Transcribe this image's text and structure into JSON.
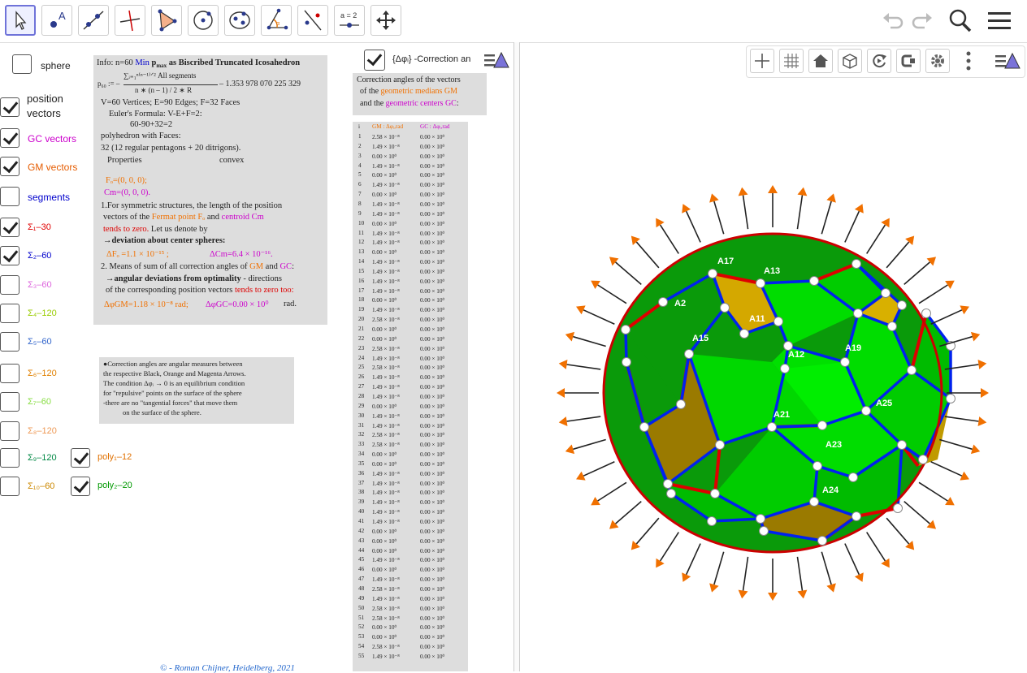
{
  "toolbar": {
    "tools": [
      {
        "name": "move-tool-icon"
      },
      {
        "name": "point-tool-icon",
        "glyph": "A"
      },
      {
        "name": "line-tool-icon"
      },
      {
        "name": "perpendicular-tool-icon"
      },
      {
        "name": "polygon-tool-icon"
      },
      {
        "name": "circle-tool-icon"
      },
      {
        "name": "conic-tool-icon"
      },
      {
        "name": "angle-tool-icon"
      },
      {
        "name": "reflect-tool-icon"
      },
      {
        "name": "slider-tool-icon",
        "glyph": "a = 2"
      },
      {
        "name": "move-graphics-tool-icon"
      }
    ]
  },
  "sidebar": {
    "sphere": {
      "label": "sphere",
      "checked": false
    },
    "position_vectors": {
      "label_line1": "position",
      "label_line2": "vectors",
      "checked": true
    },
    "gc_vectors": {
      "label": "GC vectors",
      "checked": true,
      "color": "#cc00cc"
    },
    "gm_vectors": {
      "label": "GM vectors",
      "checked": true,
      "color": "#e65c00"
    },
    "segments": {
      "label": "segments",
      "checked": false,
      "color": "#0000cc"
    },
    "sigma": [
      {
        "label": "Σ₁–30",
        "checked": true,
        "color": "#e00000"
      },
      {
        "label": "Σ₂–60",
        "checked": true,
        "color": "#0000cc"
      },
      {
        "label": "Σ₃–60",
        "checked": false,
        "color": "#dd66dd"
      },
      {
        "label": "Σ₄–120",
        "checked": false,
        "color": "#99cc00"
      },
      {
        "label": "Σ₅–60",
        "checked": false,
        "color": "#3366cc"
      },
      {
        "label": "Σ₆–120",
        "checked": false,
        "color": "#e08000"
      },
      {
        "label": "Σ₇–60",
        "checked": false,
        "color": "#88dd44"
      },
      {
        "label": "Σ₈–120",
        "checked": false,
        "color": "#ee9955"
      },
      {
        "label": "Σ₉–120",
        "checked": false,
        "color": "#008844"
      },
      {
        "label": "Σ₁₀–60",
        "checked": false,
        "color": "#cc8800"
      }
    ],
    "poly1": {
      "label": "poly₁–12",
      "checked": true,
      "color": "#e07000"
    },
    "poly2": {
      "label": "poly₂–20",
      "checked": true,
      "color": "#009900"
    }
  },
  "info": {
    "line1_a": "Info: n=60 ",
    "line1_min": "Min",
    "line1_b": " p",
    "line1_sub": "max",
    "line1_c": " as Biscribed Truncated Icosahedron",
    "formula_lhs": "p₆₀ := –",
    "formula_sum": "∑ᵢ₌₁ⁿ⁽ⁿ⁻¹⁾ᐟ² All segments",
    "formula_den": "n ∗ (n – 1) / 2 ∗ R",
    "formula_val": "– 1.353 978 070 225 329",
    "vef": "V=60 Vertices; E=90 Edges; F=32 Faces",
    "euler": "Euler's Formula: V-E+F=2:",
    "euler_val": "60-90+32=2",
    "faces1": "polyhedron with Faces:",
    "faces2": "32  (12 regular pentagons + 20 ditrigons).",
    "props": "Properties",
    "convex": "convex",
    "fo": "Fₒ=(0, 0, 0);",
    "cm": "Cm=(0, 0, 0).",
    "p1_a": "1.For symmetric structures, the length of the position",
    "p1_b1": "vectors of the ",
    "p1_b2": "Fermat point  Fₒ",
    "p1_b3": " and ",
    "p1_b4": "centroid Cm",
    "p1_c": "tends to zero.",
    "p1_c2": " Let us denote by",
    "p1_d": "→deviation about center spheres:",
    "dfo": "ΔFₒ =1.1 × 10⁻¹⁵ ;",
    "dcm": "ΔCm=6.4 × 10⁻¹⁶.",
    "p2_a1": "2. Means of sum of all correction angles of ",
    "p2_gm": "GM",
    "p2_and": " and ",
    "p2_gc": "GC",
    "p2_colon": ":",
    "p2_b": "→angular deviations from optimality",
    "p2_b2": " - directions",
    "p2_c1": "of the corresponding position vectors ",
    "p2_c2": "tends to zero too:",
    "dgm": "ΔφGM=1.18 × 10⁻⁸  rad;",
    "dgc": "ΔφGC=0.00 × 10⁰",
    "rad": "rad."
  },
  "note": {
    "l1": "●Correction angles are angular measures between",
    "l2": "the respective Black, Orange and Magenta Arrows.",
    "l3": "The condition Δφᵢ → 0 is an equilibrium condition",
    "l4": "for \"repulsive\" points on the surface of the sphere",
    "l5": "-there are no \"tangential forces\" that move them",
    "l6": "on the surface of the sphere."
  },
  "correction": {
    "checkbox_label": "{Δφᵢ} -Correction an",
    "checked": true,
    "l1": "Correction angles of the vectors",
    "l2a": "of the  ",
    "l2b": "geometric medians GM",
    "l3a": "and the ",
    "l3b": "geometric centers  GC",
    "l3c": ":"
  },
  "table": {
    "h_i": "i",
    "h_gm": "GM : Δφᵢ,rad",
    "h_gc": "GC : Δφᵢ,rad",
    "rows": [
      [
        "1",
        "2.58 × 10⁻⁸",
        "0.00 × 10⁰"
      ],
      [
        "2",
        "1.49 × 10⁻⁸",
        "0.00 × 10⁰"
      ],
      [
        "3",
        "0.00 × 10⁰",
        "0.00 × 10⁰"
      ],
      [
        "4",
        "1.49 × 10⁻⁸",
        "0.00 × 10⁰"
      ],
      [
        "5",
        "0.00 × 10⁰",
        "0.00 × 10⁰"
      ],
      [
        "6",
        "1.49 × 10⁻⁸",
        "0.00 × 10⁰"
      ],
      [
        "7",
        "0.00 × 10⁰",
        "0.00 × 10⁰"
      ],
      [
        "8",
        "1.49 × 10⁻⁸",
        "0.00 × 10⁰"
      ],
      [
        "9",
        "1.49 × 10⁻⁸",
        "0.00 × 10⁰"
      ],
      [
        "10",
        "0.00 × 10⁰",
        "0.00 × 10⁰"
      ],
      [
        "11",
        "1.49 × 10⁻⁸",
        "0.00 × 10⁰"
      ],
      [
        "12",
        "1.49 × 10⁻⁸",
        "0.00 × 10⁰"
      ],
      [
        "13",
        "0.00 × 10⁰",
        "0.00 × 10⁰"
      ],
      [
        "14",
        "1.49 × 10⁻⁸",
        "0.00 × 10⁰"
      ],
      [
        "15",
        "1.49 × 10⁻⁸",
        "0.00 × 10⁰"
      ],
      [
        "16",
        "1.49 × 10⁻⁸",
        "0.00 × 10⁰"
      ],
      [
        "17",
        "1.49 × 10⁻⁸",
        "0.00 × 10⁰"
      ],
      [
        "18",
        "0.00 × 10⁰",
        "0.00 × 10⁰"
      ],
      [
        "19",
        "1.49 × 10⁻⁸",
        "0.00 × 10⁰"
      ],
      [
        "20",
        "2.58 × 10⁻⁸",
        "0.00 × 10⁰"
      ],
      [
        "21",
        "0.00 × 10⁰",
        "0.00 × 10⁰"
      ],
      [
        "22",
        "0.00 × 10⁰",
        "0.00 × 10⁰"
      ],
      [
        "23",
        "2.58 × 10⁻⁸",
        "0.00 × 10⁰"
      ],
      [
        "24",
        "1.49 × 10⁻⁸",
        "0.00 × 10⁰"
      ],
      [
        "25",
        "2.58 × 10⁻⁸",
        "0.00 × 10⁰"
      ],
      [
        "26",
        "1.49 × 10⁻⁸",
        "0.00 × 10⁰"
      ],
      [
        "27",
        "1.49 × 10⁻⁸",
        "0.00 × 10⁰"
      ],
      [
        "28",
        "1.49 × 10⁻⁸",
        "0.00 × 10⁰"
      ],
      [
        "29",
        "0.00 × 10⁰",
        "0.00 × 10⁰"
      ],
      [
        "30",
        "1.49 × 10⁻⁸",
        "0.00 × 10⁰"
      ],
      [
        "31",
        "1.49 × 10⁻⁸",
        "0.00 × 10⁰"
      ],
      [
        "32",
        "2.58 × 10⁻⁸",
        "0.00 × 10⁰"
      ],
      [
        "33",
        "2.58 × 10⁻⁸",
        "0.00 × 10⁰"
      ],
      [
        "34",
        "0.00 × 10⁰",
        "0.00 × 10⁰"
      ],
      [
        "35",
        "0.00 × 10⁰",
        "0.00 × 10⁰"
      ],
      [
        "36",
        "1.49 × 10⁻⁸",
        "0.00 × 10⁰"
      ],
      [
        "37",
        "1.49 × 10⁻⁸",
        "0.00 × 10⁰"
      ],
      [
        "38",
        "1.49 × 10⁻⁸",
        "0.00 × 10⁰"
      ],
      [
        "39",
        "1.49 × 10⁻⁸",
        "0.00 × 10⁰"
      ],
      [
        "40",
        "1.49 × 10⁻⁸",
        "0.00 × 10⁰"
      ],
      [
        "41",
        "1.49 × 10⁻⁸",
        "0.00 × 10⁰"
      ],
      [
        "42",
        "0.00 × 10⁰",
        "0.00 × 10⁰"
      ],
      [
        "43",
        "0.00 × 10⁰",
        "0.00 × 10⁰"
      ],
      [
        "44",
        "0.00 × 10⁰",
        "0.00 × 10⁰"
      ],
      [
        "45",
        "1.49 × 10⁻⁸",
        "0.00 × 10⁰"
      ],
      [
        "46",
        "0.00 × 10⁰",
        "0.00 × 10⁰"
      ],
      [
        "47",
        "1.49 × 10⁻⁸",
        "0.00 × 10⁰"
      ],
      [
        "48",
        "2.58 × 10⁻⁸",
        "0.00 × 10⁰"
      ],
      [
        "49",
        "1.49 × 10⁻⁸",
        "0.00 × 10⁰"
      ],
      [
        "50",
        "2.58 × 10⁻⁸",
        "0.00 × 10⁰"
      ],
      [
        "51",
        "2.58 × 10⁻⁸",
        "0.00 × 10⁰"
      ],
      [
        "52",
        "0.00 × 10⁰",
        "0.00 × 10⁰"
      ],
      [
        "53",
        "0.00 × 10⁰",
        "0.00 × 10⁰"
      ],
      [
        "54",
        "2.58 × 10⁻⁸",
        "0.00 × 10⁰"
      ],
      [
        "55",
        "1.49 × 10⁻⁸",
        "0.00 × 10⁰"
      ]
    ]
  },
  "footer": {
    "credit": "© - Roman Chijner, Heidelberg, 2021"
  },
  "graphics": {
    "labels": [
      "A17",
      "A13",
      "A2",
      "A11",
      "A15",
      "A12",
      "A19",
      "A25",
      "A21",
      "A23",
      "A24"
    ]
  },
  "colors": {
    "accent": "#6f73d9",
    "green": "#00cc00",
    "gold": "#ccaa00",
    "arrow_orange": "#f07000",
    "edge_red": "#dd0000",
    "edge_blue": "#0022ee"
  }
}
